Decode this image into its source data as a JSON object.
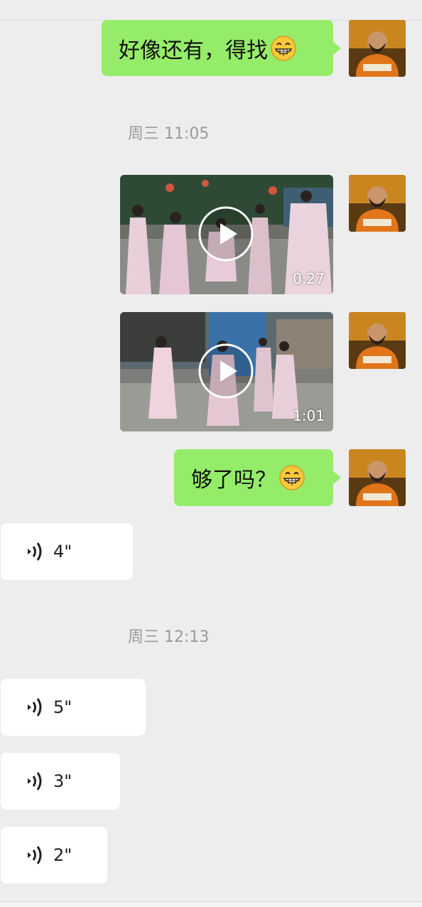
{
  "messages": {
    "m1": {
      "text": "好像还有，得找",
      "emoji": "grin-emoji"
    },
    "ts1": "周三 11:05",
    "video1": {
      "duration": "0:27"
    },
    "video2": {
      "duration": "1:01"
    },
    "m2": {
      "text": "够了吗？",
      "emoji": "grin-emoji"
    },
    "voice1": {
      "length": "4\""
    },
    "ts2": "周三 12:13",
    "voice2": {
      "length": "5\""
    },
    "voice3": {
      "length": "3\""
    },
    "voice4": {
      "length": "2\""
    }
  },
  "colors": {
    "background": "#ededed",
    "sent_bubble": "#95ec69",
    "received_bubble": "#ffffff",
    "timestamp": "#9a9a9a"
  },
  "icons": {
    "voice": "voice-wave-icon",
    "play": "play-icon",
    "avatar": "avatar"
  }
}
